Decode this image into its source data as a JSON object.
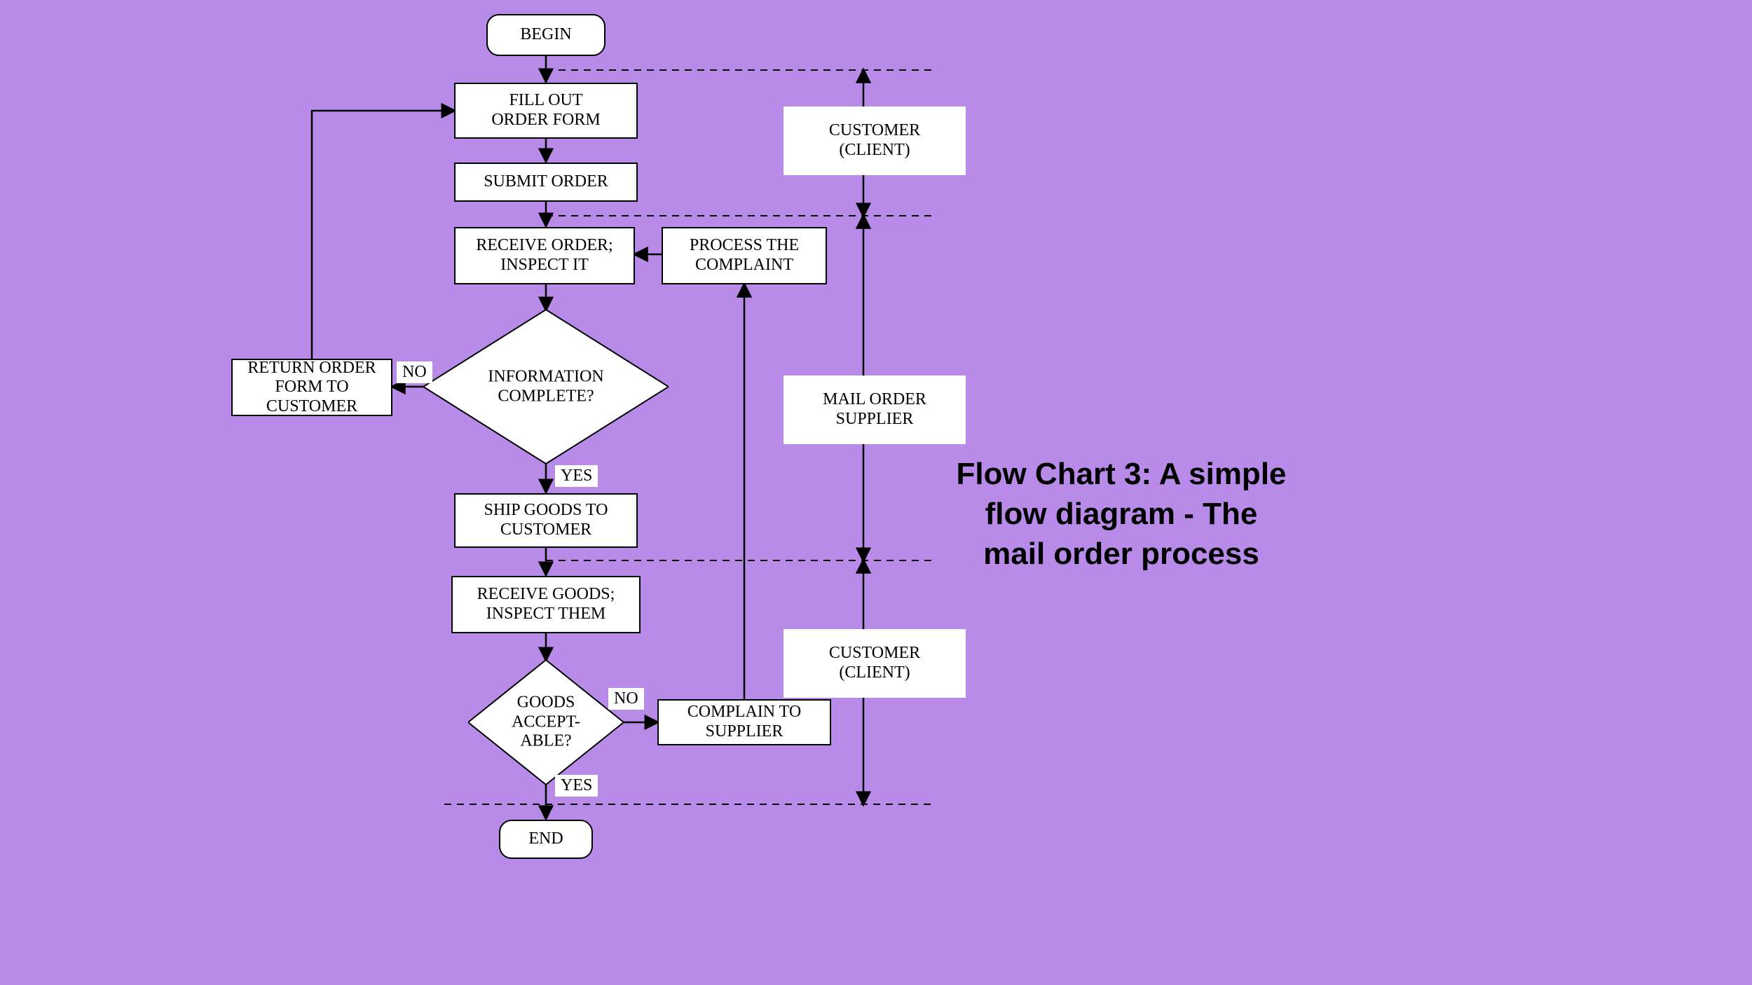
{
  "title": "Flow Chart 3:  A simple flow diagram - The mail order process",
  "nodes": {
    "begin": "BEGIN",
    "fill_out": "FILL OUT\nORDER FORM",
    "submit": "SUBMIT ORDER",
    "receive_order": "RECEIVE ORDER;\nINSPECT IT",
    "process_complaint": "PROCESS THE\nCOMPLAINT",
    "info_complete": "INFORMATION\nCOMPLETE?",
    "return_form": "RETURN ORDER\nFORM TO\nCUSTOMER",
    "ship_goods": "SHIP GOODS TO\nCUSTOMER",
    "receive_goods": "RECEIVE GOODS;\nINSPECT THEM",
    "goods_acceptable": "GOODS\nACCEPT-\nABLE?",
    "complain": "COMPLAIN TO\nSUPPLIER",
    "end": "END"
  },
  "labels": {
    "no1": "NO",
    "yes1": "YES",
    "no2": "NO",
    "yes2": "YES"
  },
  "lanes": {
    "customer_top": "CUSTOMER\n(CLIENT)",
    "supplier": "MAIL ORDER\nSUPPLIER",
    "customer_bottom": "CUSTOMER\n(CLIENT)"
  }
}
